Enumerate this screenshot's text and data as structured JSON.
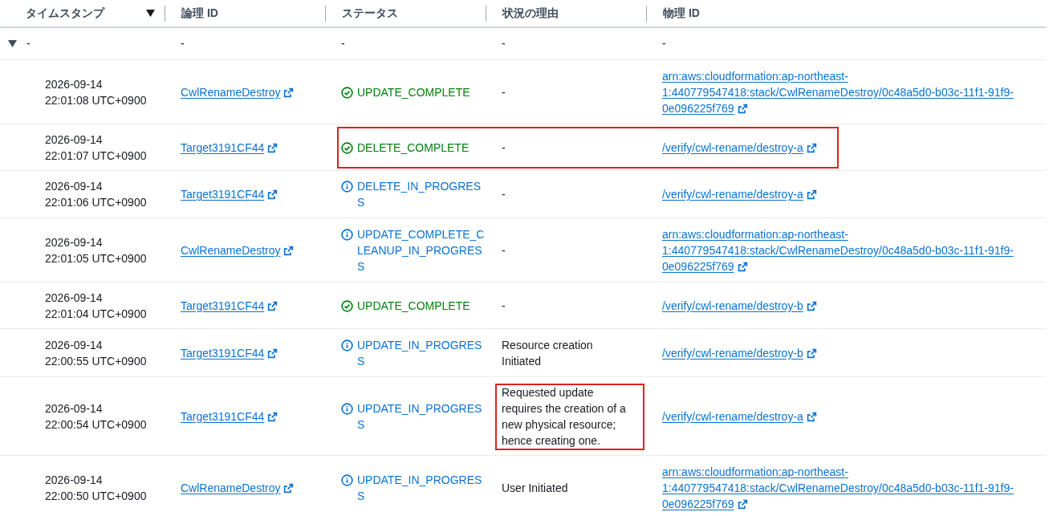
{
  "table": {
    "columns": [
      {
        "label": "タイムスタンプ",
        "sorted": true
      },
      {
        "label": "論理 ID",
        "sorted": false
      },
      {
        "label": "ステータス",
        "sorted": false
      },
      {
        "label": "状況の理由",
        "sorted": false
      },
      {
        "label": "物理 ID",
        "sorted": false
      }
    ],
    "group": {
      "expanded": true,
      "cells": [
        "-",
        "-",
        "-",
        "-",
        "-"
      ]
    },
    "rows": [
      {
        "timestamp": [
          "2026-09-14",
          "22:01:08 UTC+0900"
        ],
        "logical_id": "CwlRenameDestroy",
        "status": "UPDATE_COMPLETE",
        "kind": "success",
        "reason": "-",
        "physical_id": "arn:aws:cloudformation:ap-northeast-1:440779547418:stack/CwlRenameDestroy/0c48a5d0-b03c-11f1-91f9-0e096225f769",
        "highlighted": false,
        "reason_highlighted": false
      },
      {
        "timestamp": [
          "2026-09-14",
          "22:01:07 UTC+0900"
        ],
        "logical_id": "Target3191CF44",
        "status": "DELETE_COMPLETE",
        "kind": "success",
        "reason": "-",
        "physical_id": "/verify/cwl-rename/destroy-a",
        "highlighted": true,
        "reason_highlighted": false
      },
      {
        "timestamp": [
          "2026-09-14",
          "22:01:06 UTC+0900"
        ],
        "logical_id": "Target3191CF44",
        "status": "DELETE_IN_PROGRESS",
        "kind": "info",
        "reason": "-",
        "physical_id": "/verify/cwl-rename/destroy-a",
        "highlighted": false,
        "reason_highlighted": false
      },
      {
        "timestamp": [
          "2026-09-14",
          "22:01:05 UTC+0900"
        ],
        "logical_id": "CwlRenameDestroy",
        "status": "UPDATE_COMPLETE_CLEANUP_IN_PROGRESS",
        "kind": "info",
        "reason": "-",
        "physical_id": "arn:aws:cloudformation:ap-northeast-1:440779547418:stack/CwlRenameDestroy/0c48a5d0-b03c-11f1-91f9-0e096225f769",
        "highlighted": false,
        "reason_highlighted": false
      },
      {
        "timestamp": [
          "2026-09-14",
          "22:01:04 UTC+0900"
        ],
        "logical_id": "Target3191CF44",
        "status": "UPDATE_COMPLETE",
        "kind": "success",
        "reason": "-",
        "physical_id": "/verify/cwl-rename/destroy-b",
        "highlighted": false,
        "reason_highlighted": false
      },
      {
        "timestamp": [
          "2026-09-14",
          "22:00:55 UTC+0900"
        ],
        "logical_id": "Target3191CF44",
        "status": "UPDATE_IN_PROGRESS",
        "kind": "info",
        "reason": "Resource creation Initiated",
        "physical_id": "/verify/cwl-rename/destroy-b",
        "highlighted": false,
        "reason_highlighted": false
      },
      {
        "timestamp": [
          "2026-09-14",
          "22:00:54 UTC+0900"
        ],
        "logical_id": "Target3191CF44",
        "status": "UPDATE_IN_PROGRESS",
        "kind": "info",
        "reason": "Requested update requires the creation of a new physical resource; hence creating one.",
        "physical_id": "/verify/cwl-rename/destroy-a",
        "highlighted": false,
        "reason_highlighted": true
      },
      {
        "timestamp": [
          "2026-09-14",
          "22:00:50 UTC+0900"
        ],
        "logical_id": "CwlRenameDestroy",
        "status": "UPDATE_IN_PROGRESS",
        "kind": "info",
        "reason": "User Initiated",
        "physical_id": "arn:aws:cloudformation:ap-northeast-1:440779547418:stack/CwlRenameDestroy/0c48a5d0-b03c-11f1-91f9-0e096225f769",
        "highlighted": false,
        "reason_highlighted": false
      }
    ]
  }
}
